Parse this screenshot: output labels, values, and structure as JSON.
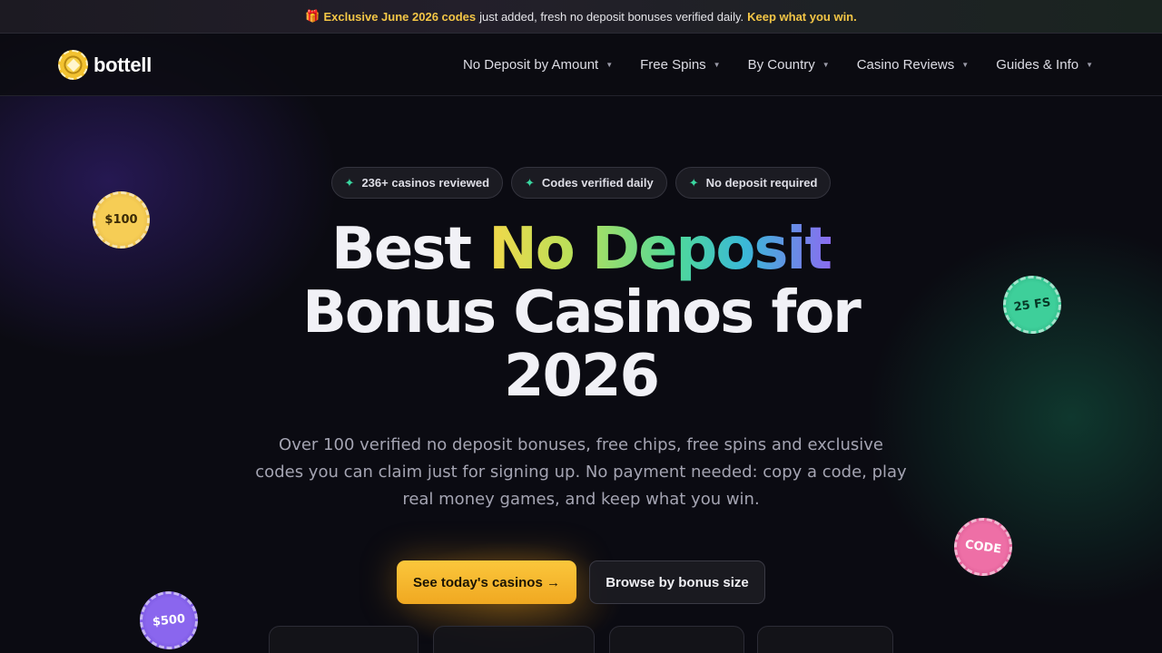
{
  "announcement": {
    "gift_icon": "gift-icon",
    "highlight": "Exclusive June 2026 codes",
    "text": "just added, fresh no deposit bonuses verified daily.",
    "link": "Keep what you win."
  },
  "header": {
    "logo_text": "bottell",
    "nav": [
      {
        "label": "No Deposit by Amount"
      },
      {
        "label": "Free Spins"
      },
      {
        "label": "By Country"
      },
      {
        "label": "Casino Reviews"
      },
      {
        "label": "Guides & Info"
      }
    ]
  },
  "hero": {
    "badges": [
      {
        "icon": "sparkle-icon",
        "label": "236+ casinos reviewed"
      },
      {
        "icon": "sparkle-icon",
        "label": "Codes verified daily"
      },
      {
        "icon": "sparkle-icon",
        "label": "No deposit required"
      }
    ],
    "title_plain_1": "Best",
    "title_gradient": "No Deposit",
    "title_line2": "Bonus Casinos for",
    "title_line3": "2026",
    "subtitle_lines": [
      "Over 100 verified no deposit bonuses, free chips, free spins and exclusive",
      "codes you can claim just for signing up. No payment needed: copy a code, play",
      "real money games, and keep what you win."
    ],
    "primary_cta": "See today's casinos →",
    "secondary_cta": "Browse by bonus size"
  },
  "chips": {
    "chip_100": "$100",
    "chip_25fs": "25 FS",
    "chip_code": "CODE",
    "chip_500": "$500"
  },
  "colors": {
    "accent_gold": "#f3c646",
    "accent_green": "#3ad6a0",
    "cta_yellow": "#fbc73c"
  }
}
